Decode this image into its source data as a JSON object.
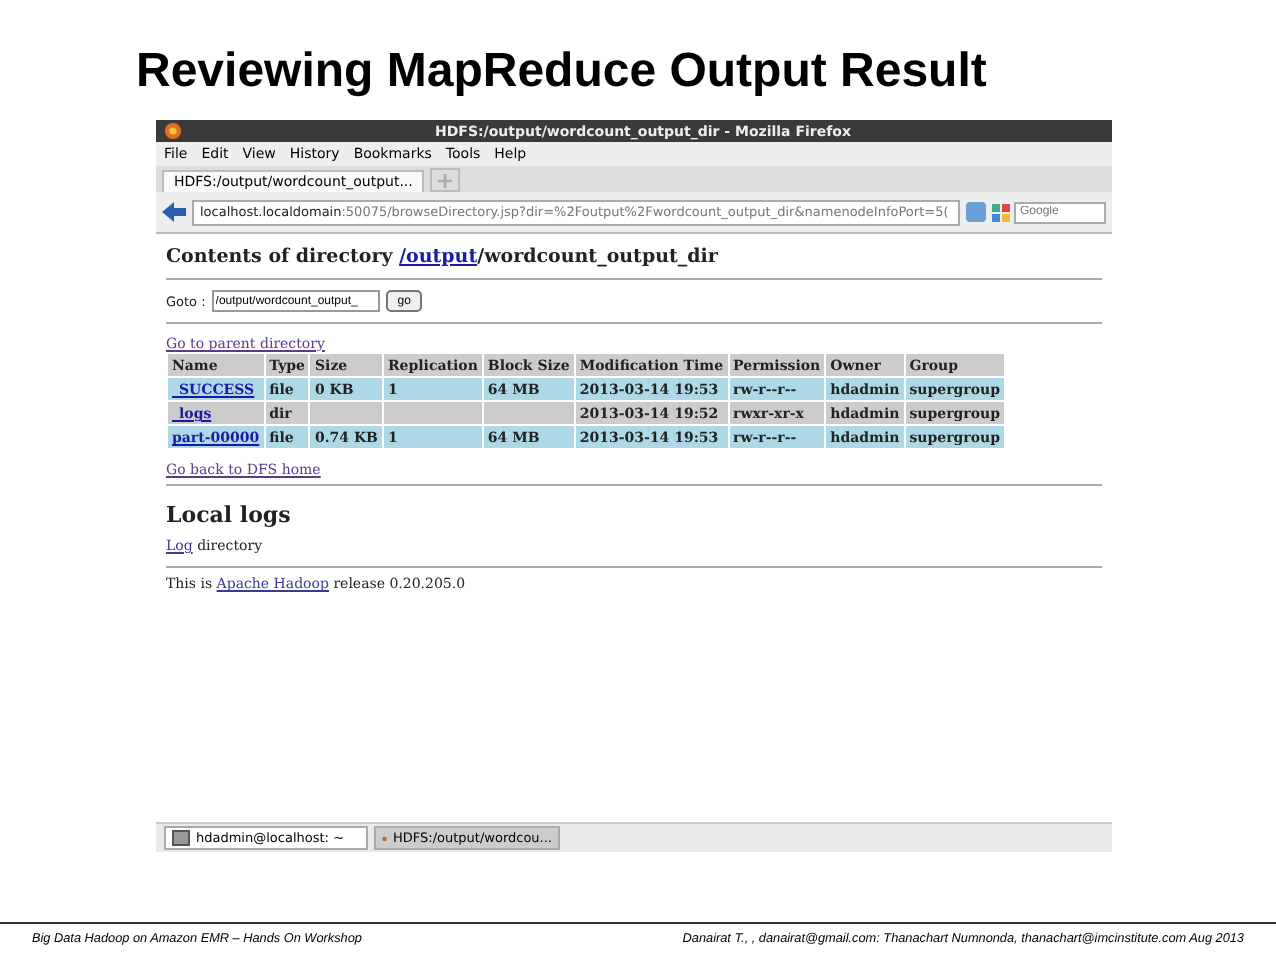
{
  "slide_title": "Reviewing MapReduce Output Result",
  "window": {
    "title": "HDFS:/output/wordcount_output_dir - Mozilla Firefox"
  },
  "menu": [
    "File",
    "Edit",
    "View",
    "History",
    "Bookmarks",
    "Tools",
    "Help"
  ],
  "tabs": [
    {
      "label": "HDFS:/output/wordcount_output...",
      "selected": true
    }
  ],
  "address_bar": {
    "host": "localhost.localdomain",
    "rest": ":50075/browseDirectory.jsp?dir=%2Foutput%2Fwordcount_output_dir&namenodeInfoPort=5("
  },
  "search": {
    "placeholder": "Google"
  },
  "page": {
    "heading_prefix": "Contents of directory ",
    "heading_link": "/output",
    "heading_rest": "/wordcount_output_dir",
    "goto_label": "Goto :",
    "goto_value": "/output/wordcount_output_",
    "goto_button": "go",
    "parent_link": "Go to parent directory",
    "table": {
      "columns": [
        "Name",
        "Type",
        "Size",
        "Replication",
        "Block Size",
        "Modification Time",
        "Permission",
        "Owner",
        "Group"
      ],
      "rows": [
        {
          "kind": "file",
          "cells": [
            "_SUCCESS",
            "file",
            "0 KB",
            "1",
            "64 MB",
            "2013-03-14 19:53",
            "rw-r--r--",
            "hdadmin",
            "supergroup"
          ]
        },
        {
          "kind": "dir",
          "cells": [
            "_logs",
            "dir",
            "",
            "",
            "",
            "2013-03-14 19:52",
            "rwxr-xr-x",
            "hdadmin",
            "supergroup"
          ]
        },
        {
          "kind": "file",
          "cells": [
            "part-00000",
            "file",
            "0.74 KB",
            "1",
            "64 MB",
            "2013-03-14 19:53",
            "rw-r--r--",
            "hdadmin",
            "supergroup"
          ]
        }
      ]
    },
    "home_link": "Go back to DFS home",
    "local_logs_heading": "Local logs",
    "log_link": "Log",
    "log_rest": " directory",
    "footer_prefix": "This is ",
    "footer_link": "Apache Hadoop",
    "footer_rest": " release 0.20.205.0"
  },
  "taskbar": [
    {
      "label": "hdadmin@localhost: ~",
      "kind": "terminal",
      "selected": false
    },
    {
      "label": "HDFS:/output/wordcou...",
      "kind": "browser",
      "selected": true
    }
  ],
  "slide_footer": {
    "left": "Big Data Hadoop on Amazon EMR – Hands On Workshop",
    "right": "Danairat T., , danairat@gmail.com:  Thanachart Numnonda,  thanachart@imcinstitute.com   Aug 2013"
  }
}
